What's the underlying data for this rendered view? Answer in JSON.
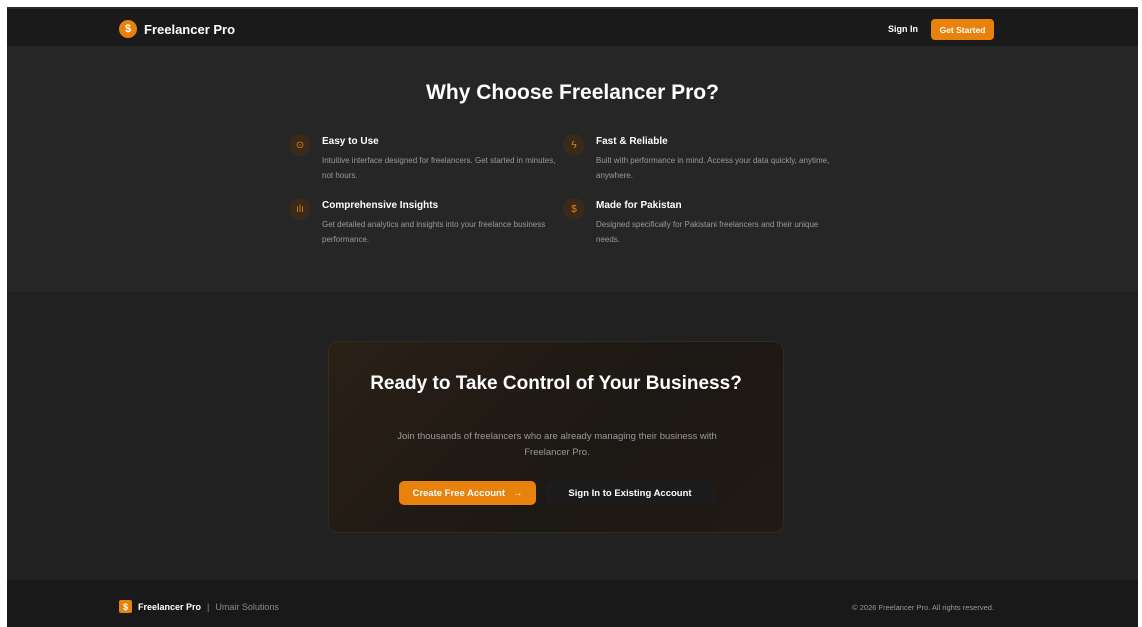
{
  "header": {
    "brand_icon": "$",
    "brand_name": "Freelancer Pro",
    "signin_label": "Sign In",
    "get_started_label": "Get Started"
  },
  "features": {
    "title": "Why Choose Freelancer Pro?",
    "items": [
      {
        "icon": "check-circle-icon",
        "glyph": "⊙",
        "title": "Easy to Use",
        "desc": "Intuitive interface designed for freelancers. Get started in minutes, not hours."
      },
      {
        "icon": "lightning-icon",
        "glyph": "ϟ",
        "title": "Fast & Reliable",
        "desc": "Built with performance in mind. Access your data quickly, anytime, anywhere."
      },
      {
        "icon": "bar-chart-icon",
        "glyph": "ılı",
        "title": "Comprehensive Insights",
        "desc": "Get detailed analytics and insights into your freelance business performance."
      },
      {
        "icon": "dollar-icon",
        "glyph": "$",
        "title": "Made for Pakistan",
        "desc": "Designed specifically for Pakistani freelancers and their unique needs."
      }
    ]
  },
  "cta": {
    "title": "Ready to Take Control of Your Business?",
    "desc": "Join thousands of freelancers who are already managing their business with Freelancer Pro.",
    "create_label": "Create Free Account",
    "create_arrow": "→",
    "signin_label": "Sign In to Existing Account"
  },
  "footer": {
    "logo_glyph": "$",
    "brand_name": "Freelancer Pro",
    "separator": "|",
    "company": "Umair Solutions",
    "copyright": "© 2026 Freelancer Pro. All rights reserved."
  },
  "colors": {
    "accent": "#e8820c",
    "background": "#202020"
  }
}
